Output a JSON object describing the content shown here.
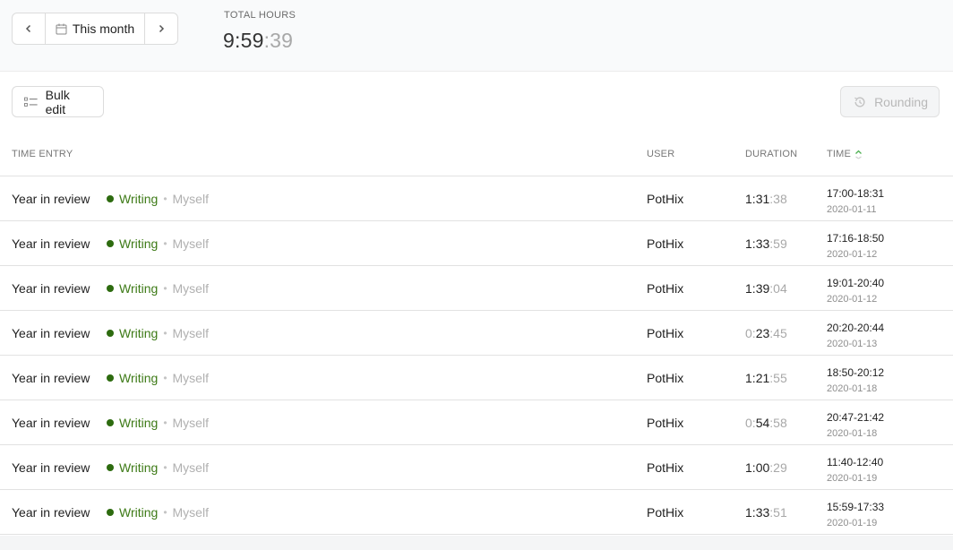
{
  "header": {
    "period_label": "This month",
    "total_label": "TOTAL HOURS",
    "total_main": "9:59",
    "total_seconds": ":39"
  },
  "toolbar": {
    "bulk_edit_label": "Bulk edit",
    "rounding_label": "Rounding"
  },
  "table": {
    "columns": {
      "entry": "TIME ENTRY",
      "user": "USER",
      "duration": "DURATION",
      "time": "TIME"
    },
    "project_color": "#2d6b0f",
    "rows": [
      {
        "title": "Year in review",
        "project": "Writing",
        "client": "Myself",
        "user": "PotHix",
        "dur_h": "1",
        "dur_m": "31",
        "dur_s": ":38",
        "range": "17:00-18:31",
        "date": "2020-01-11"
      },
      {
        "title": "Year in review",
        "project": "Writing",
        "client": "Myself",
        "user": "PotHix",
        "dur_h": "1",
        "dur_m": "33",
        "dur_s": ":59",
        "range": "17:16-18:50",
        "date": "2020-01-12"
      },
      {
        "title": "Year in review",
        "project": "Writing",
        "client": "Myself",
        "user": "PotHix",
        "dur_h": "1",
        "dur_m": "39",
        "dur_s": ":04",
        "range": "19:01-20:40",
        "date": "2020-01-12"
      },
      {
        "title": "Year in review",
        "project": "Writing",
        "client": "Myself",
        "user": "PotHix",
        "dur_h": "0",
        "dur_m": "23",
        "dur_s": ":45",
        "range": "20:20-20:44",
        "date": "2020-01-13"
      },
      {
        "title": "Year in review",
        "project": "Writing",
        "client": "Myself",
        "user": "PotHix",
        "dur_h": "1",
        "dur_m": "21",
        "dur_s": ":55",
        "range": "18:50-20:12",
        "date": "2020-01-18"
      },
      {
        "title": "Year in review",
        "project": "Writing",
        "client": "Myself",
        "user": "PotHix",
        "dur_h": "0",
        "dur_m": "54",
        "dur_s": ":58",
        "range": "20:47-21:42",
        "date": "2020-01-18"
      },
      {
        "title": "Year in review",
        "project": "Writing",
        "client": "Myself",
        "user": "PotHix",
        "dur_h": "1",
        "dur_m": "00",
        "dur_s": ":29",
        "range": "11:40-12:40",
        "date": "2020-01-19"
      },
      {
        "title": "Year in review",
        "project": "Writing",
        "client": "Myself",
        "user": "PotHix",
        "dur_h": "1",
        "dur_m": "33",
        "dur_s": ":51",
        "range": "15:59-17:33",
        "date": "2020-01-19"
      }
    ]
  }
}
